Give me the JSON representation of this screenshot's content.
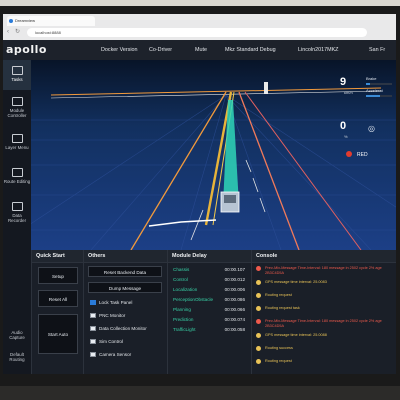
{
  "browser": {
    "tab_title": "Dreamview",
    "address": "localhost:8888"
  },
  "header": {
    "logo": "apollo",
    "items": [
      "Docker Version",
      "Co-Driver",
      "Mute",
      "Mkz Standard Debug",
      "Lincoln2017MKZ",
      "San Fr"
    ]
  },
  "sidebar": {
    "items": [
      {
        "label": "Tasks",
        "active": true
      },
      {
        "label": "Module Controller"
      },
      {
        "label": "Layer Menu"
      },
      {
        "label": "Route Editing"
      },
      {
        "label": "Data Recorder"
      }
    ],
    "bottom": [
      {
        "label": "Audio Capture"
      },
      {
        "label": "Default Routing"
      }
    ]
  },
  "hud": {
    "speed": "9",
    "speed_unit": "km/h",
    "brake_label": "Brake",
    "accel_label": "Accelerat",
    "steer": "0",
    "steer_unit": "%",
    "signal": "RED",
    "brake_level": 0.15,
    "accel_level": 0.55
  },
  "quick_start": {
    "title": "Quick Start",
    "buttons": [
      "Setup",
      "Reset All",
      "Start Auto"
    ]
  },
  "others": {
    "title": "Others",
    "buttons": [
      "Reset Backend Data",
      "Dump Message"
    ],
    "toggles": [
      {
        "label": "Lock Task Panel",
        "type": "checkbox",
        "checked": true
      },
      {
        "label": "PNC Monitor",
        "type": "switch"
      },
      {
        "label": "Data Collection Monitor",
        "type": "switch"
      },
      {
        "label": "Sim Control",
        "type": "switch"
      },
      {
        "label": "Camera Sensor",
        "type": "switch"
      }
    ]
  },
  "module_delay": {
    "title": "Module Delay",
    "rows": [
      {
        "name": "Chassis",
        "value": "00:00.107"
      },
      {
        "name": "Control",
        "value": "00:00.012"
      },
      {
        "name": "Localization",
        "value": "00:00.006"
      },
      {
        "name": "PerceptionObstacle",
        "value": "00:00.086"
      },
      {
        "name": "Planning",
        "value": "00:00.066"
      },
      {
        "name": "Prediction",
        "value": "00:00.074"
      },
      {
        "name": "TrafficLight",
        "value": "00:00.058"
      }
    ]
  },
  "console": {
    "title": "Console",
    "messages": [
      {
        "level": "error",
        "text": "Prev-Mix-Message Time-Interval: 180 message in 2502 cycle 2% age 2B3C4D5A"
      },
      {
        "level": "warn",
        "text": "GPS message time interval: 25.0083"
      },
      {
        "level": "warn",
        "text": "Routing request"
      },
      {
        "level": "warn",
        "text": "Routing request task"
      },
      {
        "level": "error",
        "text": "Prev-Mix-Message Time-Interval: 180 message in 2502 cycle 2% age 2B3C4D5A"
      },
      {
        "level": "warn",
        "text": "GPS message time interval: 25.0088"
      },
      {
        "level": "warn",
        "text": "Routing success"
      },
      {
        "level": "warn",
        "text": "Routing request"
      }
    ]
  },
  "colors": {
    "accent_green": "#38d1a6",
    "error_red": "#ef5a4c",
    "warn_yellow": "#e9c357",
    "lane_orange": "#f29a3c",
    "lane_yellow": "#e8b43a",
    "path_cyan": "#2fd6b8"
  }
}
